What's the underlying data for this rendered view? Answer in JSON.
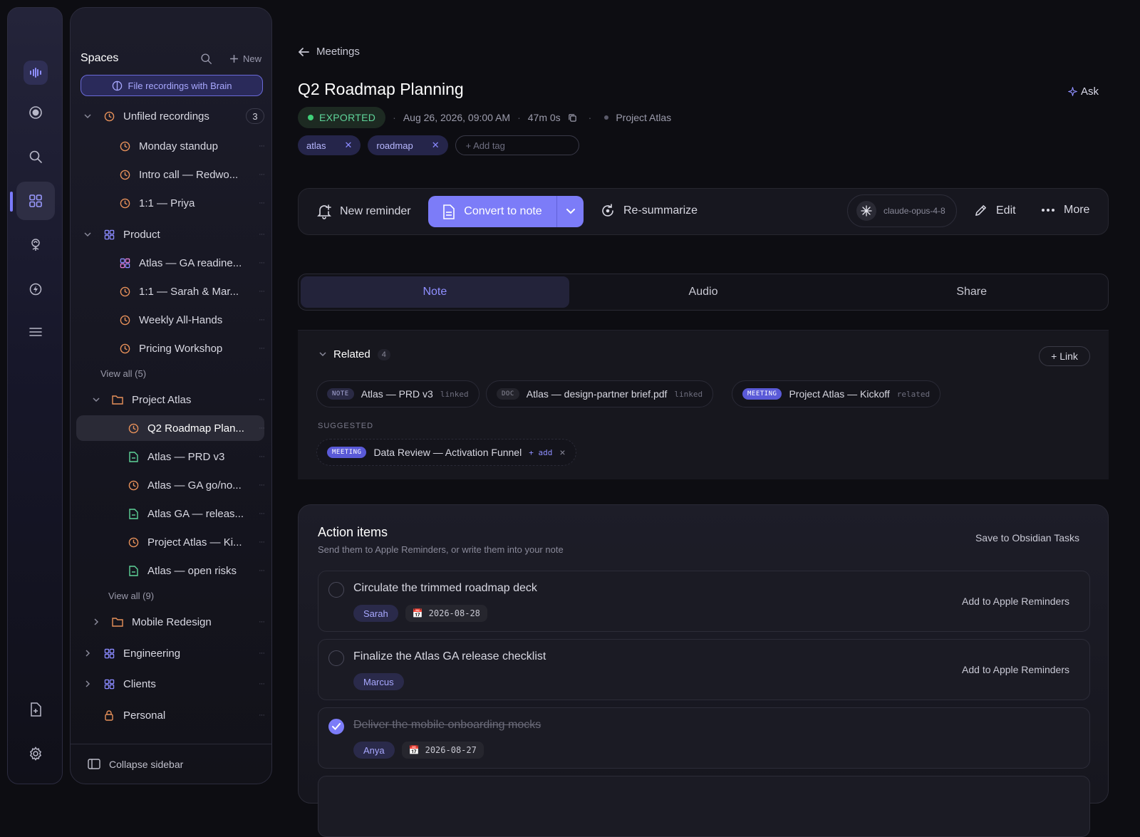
{
  "rail": {
    "icons": [
      "waveform-icon",
      "record-icon",
      "search-icon",
      "spaces-grid-icon",
      "brain-icon",
      "lightning-icon",
      "list-icon"
    ],
    "bottom_icons": [
      "add-file-icon",
      "gear-icon"
    ]
  },
  "sidebar": {
    "title": "Spaces",
    "new_label": "New",
    "brain_button": "File recordings with Brain",
    "unfiled": {
      "label": "Unfiled recordings",
      "count": "3"
    },
    "unfiled_items": [
      "Monday standup",
      "Intro call — Redwo...",
      "1:1 — Priya"
    ],
    "product": {
      "label": "Product"
    },
    "product_items": [
      "Atlas — GA readine...",
      "1:1 — Sarah & Mar...",
      "Weekly All-Hands",
      "Pricing Workshop"
    ],
    "product_view_all": "View all (5)",
    "project_atlas": {
      "label": "Project Atlas"
    },
    "atlas_items": [
      "Q2 Roadmap Plan...",
      "Atlas — PRD v3",
      "Atlas — GA go/no...",
      "Atlas GA — releas...",
      "Project Atlas — Ki...",
      "Atlas — open risks"
    ],
    "atlas_view_all": "View all (9)",
    "mobile": {
      "label": "Mobile Redesign"
    },
    "engineering": {
      "label": "Engineering"
    },
    "clients": {
      "label": "Clients"
    },
    "personal": {
      "label": "Personal"
    },
    "collapse": "Collapse sidebar",
    "colors": {
      "recording": "#e8915a",
      "note": "#5fd59a",
      "space": "#8a8aff"
    }
  },
  "header": {
    "back_label": "Meetings",
    "title": "Q2 Roadmap Planning",
    "ask_label": "Ask",
    "status": "EXPORTED",
    "datetime": "Aug 26, 2026, 09:00 AM",
    "duration": "47m 0s",
    "project": "Project Atlas",
    "tags": [
      "atlas",
      "roadmap"
    ],
    "add_tag_placeholder": "+ Add tag"
  },
  "toolbar": {
    "new_reminder": "New reminder",
    "convert": "Convert to note",
    "resummarize": "Re-summarize",
    "model": "claude-opus-4-8",
    "edit": "Edit",
    "more": "More"
  },
  "tabs": [
    "Note",
    "Audio",
    "Share"
  ],
  "related": {
    "title": "Related",
    "count": "4",
    "link_button": "+ Link",
    "chips": [
      {
        "badge": "NOTE",
        "label": "Atlas — PRD v3",
        "kind": "linked"
      },
      {
        "badge": "DOC",
        "label": "Atlas — design-partner brief.pdf",
        "kind": "linked"
      },
      {
        "badge": "MEETING",
        "label": "Project Atlas — Kickoff",
        "kind": "related"
      }
    ],
    "suggested_label": "SUGGESTED",
    "suggested": {
      "badge": "MEETING",
      "label": "Data Review — Activation Funnel",
      "add": "+ add",
      "dismiss": "×"
    }
  },
  "actions": {
    "title": "Action items",
    "subtitle": "Send them to Apple Reminders, or write them into your note",
    "obsidian": "Save to Obsidian Tasks",
    "items": [
      {
        "title": "Circulate the trimmed roadmap deck",
        "owner": "Sarah",
        "date": "2026-08-28",
        "done": false,
        "reminder": "Add to Apple Reminders"
      },
      {
        "title": "Finalize the Atlas GA release checklist",
        "owner": "Marcus",
        "date": "",
        "done": false,
        "reminder": "Add to Apple Reminders"
      },
      {
        "title": "Deliver the mobile onboarding mocks",
        "owner": "Anya",
        "date": "2026-08-27",
        "done": true,
        "reminder": ""
      }
    ]
  }
}
